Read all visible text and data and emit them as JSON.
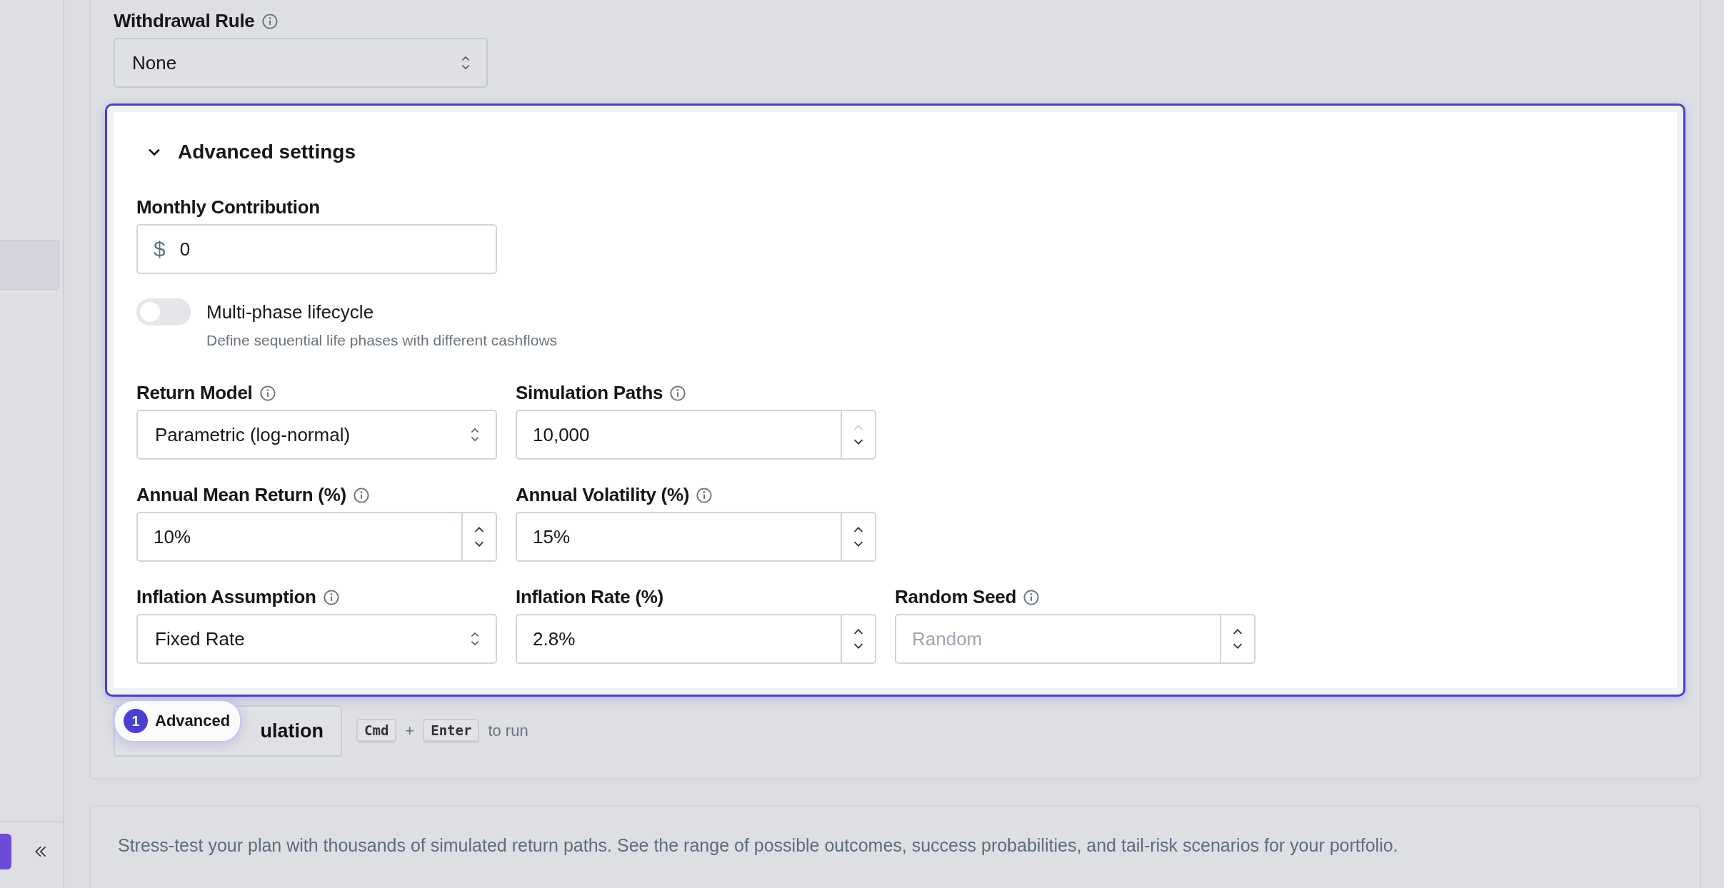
{
  "withdrawal_rule": {
    "label": "Withdrawal Rule",
    "info": true,
    "value": "None"
  },
  "advanced": {
    "title": "Advanced settings",
    "expanded": true,
    "monthly_contribution": {
      "label": "Monthly Contribution",
      "prefix": "$",
      "value": "0"
    },
    "lifecycle": {
      "label": "Multi-phase lifecycle",
      "description": "Define sequential life phases with different cashflows",
      "on": false
    },
    "rows": [
      {
        "fields": [
          {
            "kind": "select",
            "label": "Return Model",
            "info": true,
            "value": "Parametric (log-normal)"
          },
          {
            "kind": "number",
            "label": "Simulation Paths",
            "info": true,
            "value": "10,000",
            "up_disabled": true
          }
        ]
      },
      {
        "fields": [
          {
            "kind": "number",
            "label": "Annual Mean Return (%)",
            "info": true,
            "value": "10%",
            "up_disabled": false
          },
          {
            "kind": "number",
            "label": "Annual Volatility (%)",
            "info": true,
            "value": "15%",
            "up_disabled": false
          }
        ]
      },
      {
        "fields": [
          {
            "kind": "select",
            "label": "Inflation Assumption",
            "info": true,
            "value": "Fixed Rate"
          },
          {
            "kind": "number",
            "label": "Inflation Rate (%)",
            "info": false,
            "value": "2.8%",
            "up_disabled": false
          },
          {
            "kind": "number",
            "label": "Random Seed",
            "info": true,
            "placeholder": "Random",
            "up_disabled": false
          }
        ]
      }
    ]
  },
  "run_button": {
    "label": "ulation"
  },
  "shortcut": {
    "keys": [
      "Cmd",
      "Enter"
    ],
    "joiner": "+",
    "suffix": "to run"
  },
  "tour_badge": {
    "step": "1",
    "label": "Advanced"
  },
  "description": "Stress-test your plan with thousands of simulated return paths. See the range of possible outcomes, success probabilities, and tail-risk scenarios for your portfolio."
}
